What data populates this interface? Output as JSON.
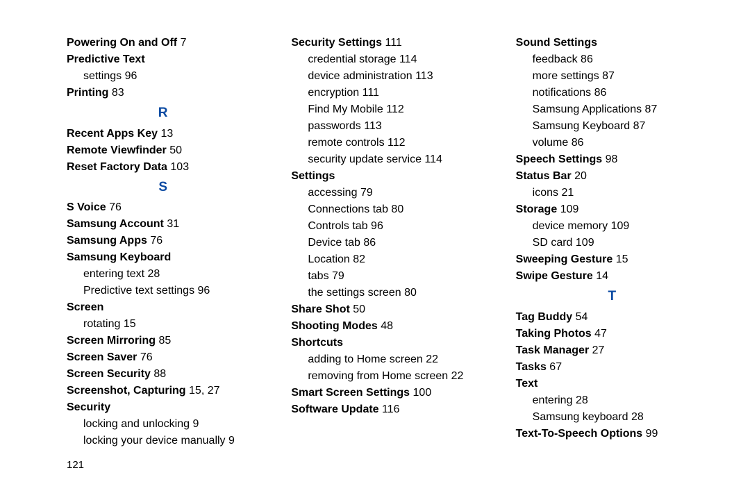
{
  "pageNumber": "121",
  "letters": {
    "r": "R",
    "s": "S",
    "t": "T"
  },
  "col1": {
    "poweringOnOff": {
      "label": "Powering On and Off",
      "page": "7"
    },
    "predictiveText": {
      "label": "Predictive Text"
    },
    "ptSettings": {
      "label": "settings",
      "page": "96"
    },
    "printing": {
      "label": "Printing",
      "page": "83"
    },
    "recentApps": {
      "label": "Recent Apps Key",
      "page": "13"
    },
    "remoteVF": {
      "label": "Remote Viewfinder",
      "page": "50"
    },
    "resetFactory": {
      "label": "Reset Factory Data",
      "page": "103"
    },
    "sVoice": {
      "label": "S Voice",
      "page": "76"
    },
    "samsungAccount": {
      "label": "Samsung Account",
      "page": "31"
    },
    "samsungApps": {
      "label": "Samsung Apps",
      "page": "76"
    },
    "samsungKeyboard": {
      "label": "Samsung Keyboard"
    },
    "skEntering": {
      "label": "entering text",
      "page": "28"
    },
    "skPredictive": {
      "label": "Predictive text settings",
      "page": "96"
    },
    "screen": {
      "label": "Screen"
    },
    "screenRotating": {
      "label": "rotating",
      "page": "15"
    },
    "screenMirroring": {
      "label": "Screen Mirroring",
      "page": "85"
    },
    "screenSaver": {
      "label": "Screen Saver",
      "page": "76"
    },
    "screenSecurity": {
      "label": "Screen Security",
      "page": "88"
    },
    "screenshot": {
      "label": "Screenshot, Capturing",
      "page": "15,  27"
    },
    "security": {
      "label": "Security"
    },
    "secLocking": {
      "label": "locking and unlocking",
      "page": "9"
    },
    "secManual": {
      "label": "locking your device manually",
      "page": "9"
    }
  },
  "col2": {
    "securitySettings": {
      "label": "Security Settings",
      "page": "111"
    },
    "ssCred": {
      "label": "credential storage",
      "page": "114"
    },
    "ssDevAdmin": {
      "label": "device administration",
      "page": "113"
    },
    "ssEncryption": {
      "label": "encryption",
      "page": "111"
    },
    "ssFindMobile": {
      "label": "Find My Mobile",
      "page": "112"
    },
    "ssPasswords": {
      "label": "passwords",
      "page": "113"
    },
    "ssRemote": {
      "label": "remote controls",
      "page": "112"
    },
    "ssUpdate": {
      "label": "security update service",
      "page": "114"
    },
    "settings": {
      "label": "Settings"
    },
    "stAccessing": {
      "label": "accessing",
      "page": "79"
    },
    "stConnections": {
      "label": "Connections tab",
      "page": "80"
    },
    "stControls": {
      "label": "Controls tab",
      "page": "96"
    },
    "stDevice": {
      "label": "Device tab",
      "page": "86"
    },
    "stLocation": {
      "label": "Location",
      "page": "82"
    },
    "stTabs": {
      "label": "tabs",
      "page": "79"
    },
    "stScreen": {
      "label": "the settings screen",
      "page": "80"
    },
    "shareShot": {
      "label": "Share Shot",
      "page": "50"
    },
    "shootingModes": {
      "label": "Shooting Modes",
      "page": "48"
    },
    "shortcuts": {
      "label": "Shortcuts"
    },
    "shAdding": {
      "label": "adding to Home screen",
      "page": "22"
    },
    "shRemoving": {
      "label": "removing from Home screen",
      "page": "22"
    },
    "smartScreen": {
      "label": "Smart Screen Settings",
      "page": "100"
    },
    "softwareUpdate": {
      "label": "Software Update",
      "page": "116"
    }
  },
  "col3": {
    "soundSettings": {
      "label": "Sound Settings"
    },
    "sndFeedback": {
      "label": "feedback",
      "page": "86"
    },
    "sndMore": {
      "label": "more settings",
      "page": "87"
    },
    "sndNotif": {
      "label": "notifications",
      "page": "86"
    },
    "sndSamsungApps": {
      "label": "Samsung Applications",
      "page": "87"
    },
    "sndSamsungKb": {
      "label": "Samsung Keyboard",
      "page": "87"
    },
    "sndVolume": {
      "label": "volume",
      "page": "86"
    },
    "speechSettings": {
      "label": "Speech Settings",
      "page": "98"
    },
    "statusBar": {
      "label": "Status Bar",
      "page": "20"
    },
    "sbIcons": {
      "label": "icons",
      "page": "21"
    },
    "storage": {
      "label": "Storage",
      "page": "109"
    },
    "stgDevMem": {
      "label": "device memory",
      "page": "109"
    },
    "stgSD": {
      "label": "SD card",
      "page": "109"
    },
    "sweepingGesture": {
      "label": "Sweeping Gesture",
      "page": "15"
    },
    "swipeGesture": {
      "label": "Swipe Gesture",
      "page": "14"
    },
    "tagBuddy": {
      "label": "Tag Buddy",
      "page": "54"
    },
    "takingPhotos": {
      "label": "Taking Photos",
      "page": "47"
    },
    "taskManager": {
      "label": "Task Manager",
      "page": "27"
    },
    "tasks": {
      "label": "Tasks",
      "page": "67"
    },
    "text": {
      "label": "Text"
    },
    "txtEntering": {
      "label": "entering",
      "page": "28"
    },
    "txtSamsungKb": {
      "label": "Samsung keyboard",
      "page": "28"
    },
    "tts": {
      "label": "Text-To-Speech Options",
      "page": "99"
    }
  }
}
